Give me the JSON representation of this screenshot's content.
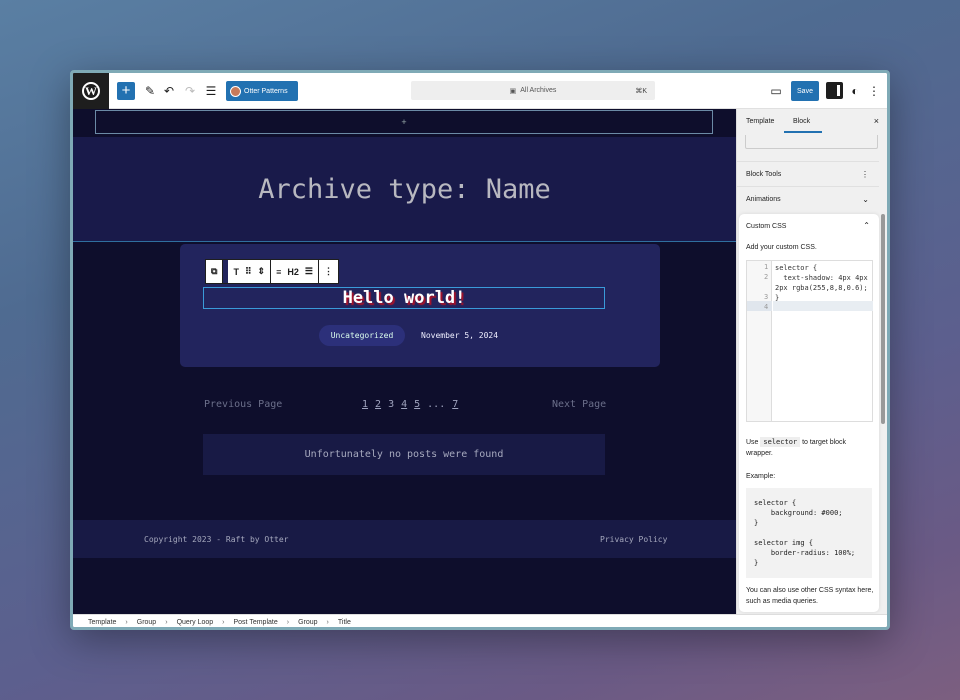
{
  "topbar": {
    "otter_label": "Otter Patterns",
    "command_label": "All Archives",
    "command_shortcut": "⌘K",
    "save_label": "Save"
  },
  "canvas": {
    "add_block": "+",
    "archive_title": "Archive type: Name",
    "post_title": "Hello world!",
    "heading_level": "H2",
    "category": "Uncategorized",
    "date": "November 5, 2024",
    "prev_page": "Previous Page",
    "next_page": "Next Page",
    "pages": [
      "1",
      "2",
      "3",
      "4",
      "5",
      "...",
      "7"
    ],
    "no_posts": "Unfortunately no posts were found",
    "footer_left": "Copyright 2023 - Raft by Otter",
    "footer_right": "Privacy Policy"
  },
  "sidebar": {
    "tab_template": "Template",
    "tab_block": "Block",
    "close": "×",
    "block_tools": "Block Tools",
    "animations": "Animations",
    "custom_css": {
      "heading": "Custom CSS",
      "description": "Add your custom CSS.",
      "line_numbers": [
        "1",
        "2",
        "",
        "3",
        "4"
      ],
      "code": "selector {\n  text-shadow: 4px 4px\n2px rgba(255,8,8,0.6);\n}",
      "use_prefix": "Use",
      "use_code": "selector",
      "use_suffix": "to target block wrapper.",
      "example_label": "Example:",
      "example_code": "selector {\n    background: #000;\n}\n\nselector img {\n    border-radius: 100%;\n}",
      "also_text": "You can also use other CSS syntax here, such as media queries."
    }
  },
  "breadcrumb": [
    "Template",
    "Group",
    "Query Loop",
    "Post Template",
    "Group",
    "Title"
  ],
  "colors": {
    "accent": "#2271b1",
    "canvas_bg": "#0e0e2c",
    "card_bg": "#22245d"
  }
}
